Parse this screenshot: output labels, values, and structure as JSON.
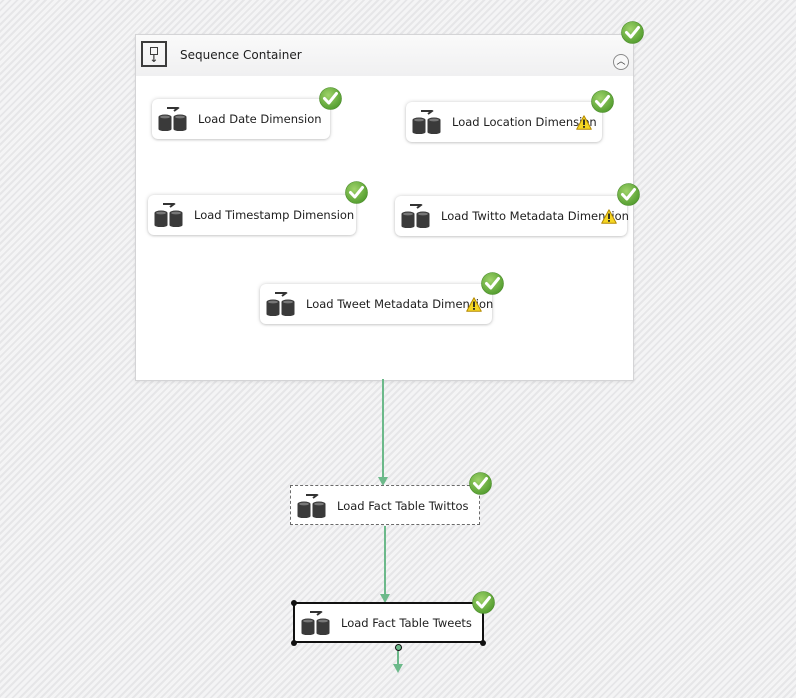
{
  "canvas": {
    "colors": {
      "connector": "#6cb98a",
      "success": "#6db33f",
      "warning": "#f2d21b"
    }
  },
  "sequence_container": {
    "title": "Sequence Container",
    "icon": "sequence-container-icon",
    "status": "success",
    "collapse_icon": "chevron-up-icon",
    "tasks": [
      {
        "label": "Load Date Dimension",
        "icon": "data-flow-task-icon",
        "status": "success",
        "warning": false
      },
      {
        "label": "Load Location Dimension",
        "icon": "data-flow-task-icon",
        "status": "success",
        "warning": true
      },
      {
        "label": "Load Timestamp Dimension",
        "icon": "data-flow-task-icon",
        "status": "success",
        "warning": false
      },
      {
        "label": "Load Twitto Metadata Dimension",
        "icon": "data-flow-task-icon",
        "status": "success",
        "warning": true
      },
      {
        "label": "Load Tweet Metadata Dimension",
        "icon": "data-flow-task-icon",
        "status": "success",
        "warning": true
      }
    ]
  },
  "tasks": [
    {
      "label": "Load Fact Table Twittos",
      "icon": "data-flow-task-icon",
      "status": "success",
      "focus": "dashed"
    },
    {
      "label": "Load Fact Table Tweets",
      "icon": "data-flow-task-icon",
      "status": "success",
      "focus": "selected"
    }
  ]
}
